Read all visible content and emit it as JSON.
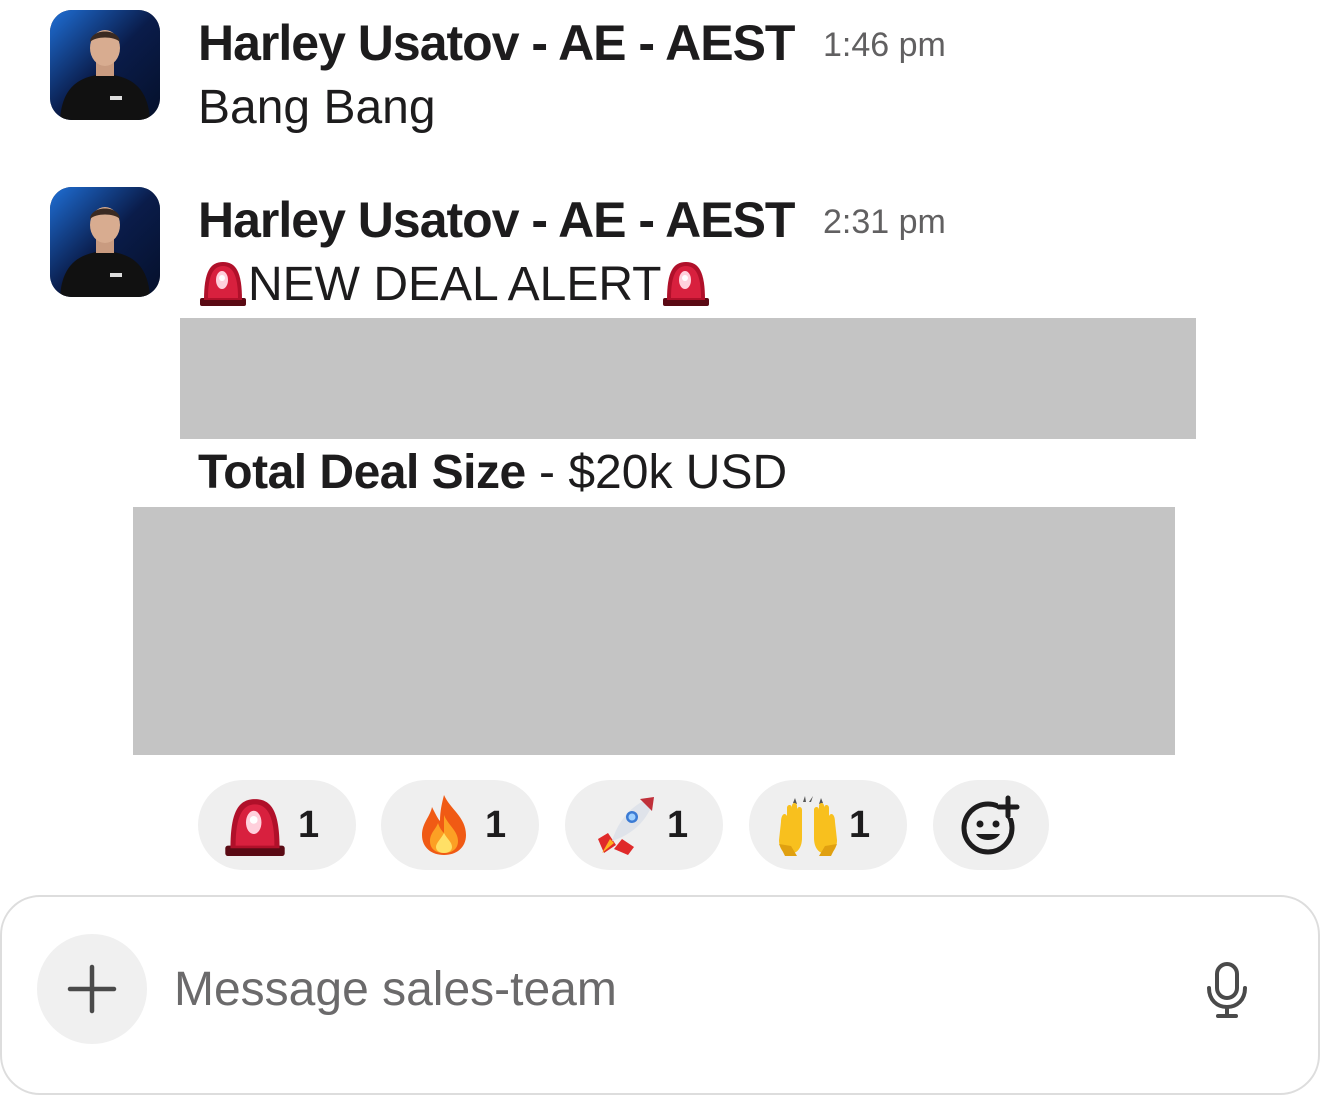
{
  "messages": [
    {
      "sender": "Harley Usatov - AE - AEST",
      "time": "1:46 pm",
      "text": "Bang Bang",
      "avatar_icon": "person-avatar"
    },
    {
      "sender": "Harley Usatov - AE - AEST",
      "time": "2:31 pm",
      "alert_text": "NEW DEAL ALERT",
      "alert_icon": "rotating-light-emoji",
      "deal_label": "Total Deal Size",
      "deal_separator": " - ",
      "deal_value": "$20k USD",
      "avatar_icon": "person-avatar"
    }
  ],
  "reactions": [
    {
      "emoji": "rotating-light",
      "count": "1"
    },
    {
      "emoji": "fire",
      "count": "1"
    },
    {
      "emoji": "rocket",
      "count": "1"
    },
    {
      "emoji": "raising-hands",
      "count": "1"
    }
  ],
  "add_reaction_icon": "add-reaction-icon",
  "composer": {
    "placeholder": "Message sales-team",
    "plus_icon": "plus-icon",
    "mic_icon": "microphone-icon"
  },
  "colors": {
    "redaction": "#c4c4c4",
    "reaction_bg": "#efefef",
    "timestamp": "#616061"
  }
}
